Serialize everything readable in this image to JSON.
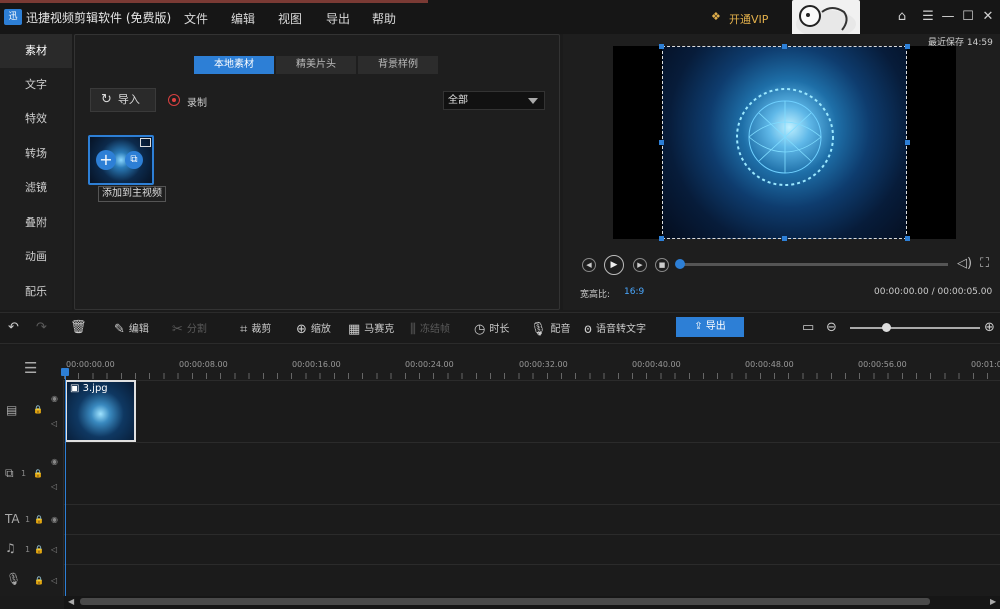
{
  "app": {
    "title": "迅捷视频剪辑软件 (免费版)",
    "logo_text": "迅",
    "menu": [
      "文件",
      "编辑",
      "视图",
      "导出",
      "帮助"
    ],
    "vip_label": "开通VIP",
    "last_saved": "最近保存 14:59",
    "window_controls": [
      "⌂",
      "☰",
      "—",
      "☐",
      "✕"
    ]
  },
  "sidebar": {
    "items": [
      {
        "label": "素材",
        "active": true
      },
      {
        "label": "文字",
        "active": false
      },
      {
        "label": "特效",
        "active": false
      },
      {
        "label": "转场",
        "active": false
      },
      {
        "label": "滤镜",
        "active": false
      },
      {
        "label": "叠附",
        "active": false
      },
      {
        "label": "动画",
        "active": false
      },
      {
        "label": "配乐",
        "active": false
      }
    ]
  },
  "media": {
    "tabs": [
      {
        "label": "本地素材",
        "active": true
      },
      {
        "label": "精美片头",
        "active": false
      },
      {
        "label": "背景样例",
        "active": false
      }
    ],
    "import_label": "导入",
    "record_label": "录制",
    "filter_value": "全部",
    "thumb_tooltip": "添加到主视频"
  },
  "preview": {
    "ratio_label": "宽高比:",
    "ratio_value": "16:9",
    "time_readout": "00:00:00.00 / 00:00:05.00",
    "progress": 0.0
  },
  "toolbar": {
    "edit": "编辑",
    "split": "分割",
    "crop": "裁剪",
    "zoom": "缩放",
    "mosaic": "马赛克",
    "freeze": "冻结帧",
    "duration": "时长",
    "dub": "配音",
    "speech_to_text": "语音转文字",
    "export": "导出",
    "zoom_level": 0.28
  },
  "timeline": {
    "ticks": [
      "00:00:00.00",
      "00:00:08.00",
      "00:00:16.00",
      "00:00:24.00",
      "00:00:32.00",
      "00:00:40.00",
      "00:00:48.00",
      "00:00:56.00",
      "00:01:0"
    ],
    "clip_name": "3.jpg",
    "track_numbers": [
      "1",
      "1",
      "1"
    ]
  },
  "colors": {
    "accent": "#2d7fd6",
    "vip": "#e3b04b",
    "record": "#e04040",
    "ratio": "#4aa8ff"
  }
}
